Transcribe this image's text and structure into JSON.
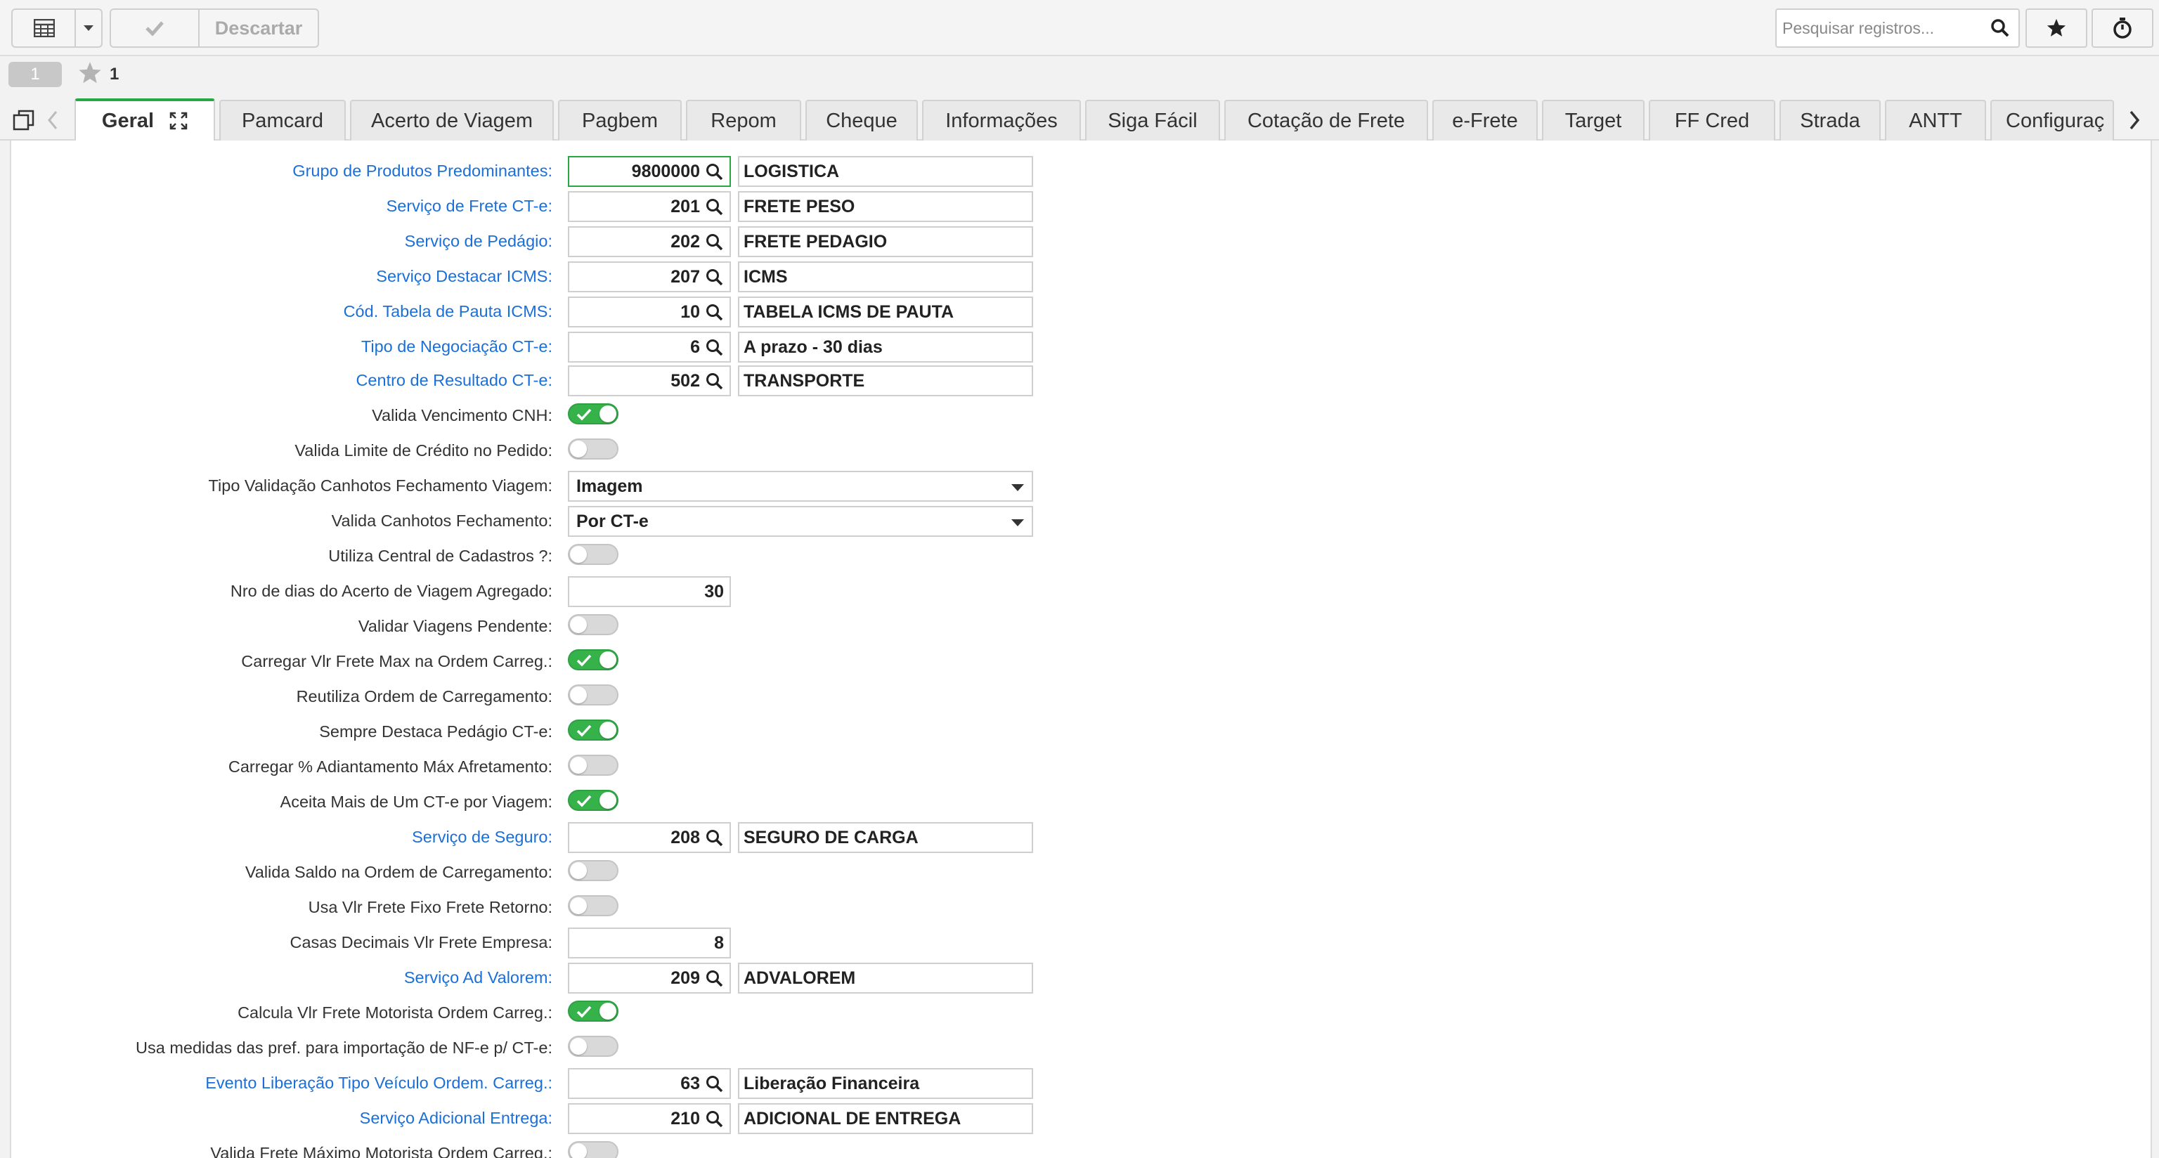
{
  "toolbar": {
    "discard_label": "Descartar",
    "search_placeholder": "Pesquisar registros..."
  },
  "recbar": {
    "page": "1",
    "favorites_count": "1"
  },
  "tabs": [
    {
      "label": "Geral",
      "active": true
    },
    {
      "label": "Pamcard"
    },
    {
      "label": "Acerto de Viagem"
    },
    {
      "label": "Pagbem"
    },
    {
      "label": "Repom"
    },
    {
      "label": "Cheque"
    },
    {
      "label": "Informações"
    },
    {
      "label": "Siga Fácil"
    },
    {
      "label": "Cotação de Frete"
    },
    {
      "label": "e-Frete"
    },
    {
      "label": "Target"
    },
    {
      "label": "FF Cred"
    },
    {
      "label": "Strada"
    },
    {
      "label": "ANTT"
    },
    {
      "label": "Configuraç"
    }
  ],
  "colors": {
    "accent": "#28a745",
    "link": "#1a6fd8",
    "toggle_on": "#36b24a"
  },
  "form": [
    {
      "label": "Grupo de Produtos Predominantes:",
      "link": true,
      "type": "lookup",
      "code": "9800000",
      "desc": "LOGISTICA",
      "focus": true
    },
    {
      "label": "Serviço de Frete CT-e:",
      "link": true,
      "type": "lookup",
      "code": "201",
      "desc": "FRETE PESO"
    },
    {
      "label": "Serviço de Pedágio:",
      "link": true,
      "type": "lookup",
      "code": "202",
      "desc": "FRETE PEDAGIO"
    },
    {
      "label": "Serviço Destacar ICMS:",
      "link": true,
      "type": "lookup",
      "code": "207",
      "desc": "ICMS"
    },
    {
      "label": "Cód. Tabela de Pauta ICMS:",
      "link": true,
      "type": "lookup",
      "code": "10",
      "desc": "TABELA ICMS DE PAUTA"
    },
    {
      "label": "Tipo de Negociação CT-e:",
      "link": true,
      "type": "lookup",
      "code": "6",
      "desc": "A prazo - 30 dias"
    },
    {
      "label": "Centro de Resultado CT-e:",
      "link": true,
      "type": "lookup",
      "code": "502",
      "desc": "TRANSPORTE"
    },
    {
      "label": "Valida Vencimento CNH:",
      "type": "toggle",
      "on": true
    },
    {
      "label": "Valida Limite de Crédito no Pedido:",
      "type": "toggle",
      "on": false
    },
    {
      "label": "Tipo Validação Canhotos Fechamento Viagem:",
      "type": "select",
      "value": "Imagem"
    },
    {
      "label": "Valida Canhotos Fechamento:",
      "type": "select",
      "value": "Por CT-e"
    },
    {
      "label": "Utiliza Central de Cadastros ?:",
      "type": "toggle",
      "on": false
    },
    {
      "label": "Nro de dias do Acerto de Viagem Agregado:",
      "type": "number",
      "value": "30"
    },
    {
      "label": "Validar Viagens Pendente:",
      "type": "toggle",
      "on": false
    },
    {
      "label": "Carregar Vlr Frete Max na Ordem Carreg.:",
      "type": "toggle",
      "on": true
    },
    {
      "label": "Reutiliza Ordem de Carregamento:",
      "type": "toggle",
      "on": false
    },
    {
      "label": "Sempre Destaca Pedágio CT-e:",
      "type": "toggle",
      "on": true
    },
    {
      "label": "Carregar % Adiantamento Máx Afretamento:",
      "type": "toggle",
      "on": false
    },
    {
      "label": "Aceita Mais de Um CT-e por Viagem:",
      "type": "toggle",
      "on": true
    },
    {
      "label": "Serviço de Seguro:",
      "link": true,
      "type": "lookup",
      "code": "208",
      "desc": "SEGURO DE CARGA"
    },
    {
      "label": "Valida Saldo na Ordem de Carregamento:",
      "type": "toggle",
      "on": false
    },
    {
      "label": "Usa Vlr Frete Fixo Frete Retorno:",
      "type": "toggle",
      "on": false
    },
    {
      "label": "Casas Decimais Vlr Frete Empresa:",
      "type": "number",
      "value": "8"
    },
    {
      "label": "Serviço Ad Valorem:",
      "link": true,
      "type": "lookup",
      "code": "209",
      "desc": "ADVALOREM"
    },
    {
      "label": "Calcula Vlr Frete Motorista Ordem Carreg.:",
      "type": "toggle",
      "on": true
    },
    {
      "label": "Usa medidas das pref. para importação de NF-e p/ CT-e:",
      "type": "toggle",
      "on": false
    },
    {
      "label": "Evento Liberação Tipo Veículo Ordem. Carreg.:",
      "link": true,
      "type": "lookup",
      "code": "63",
      "desc": "Liberação Financeira"
    },
    {
      "label": "Serviço Adicional Entrega:",
      "link": true,
      "type": "lookup",
      "code": "210",
      "desc": "ADICIONAL DE ENTREGA"
    },
    {
      "label": "Valida Frete Máximo Motorista Ordem Carreg.:",
      "type": "toggle",
      "on": false
    }
  ]
}
